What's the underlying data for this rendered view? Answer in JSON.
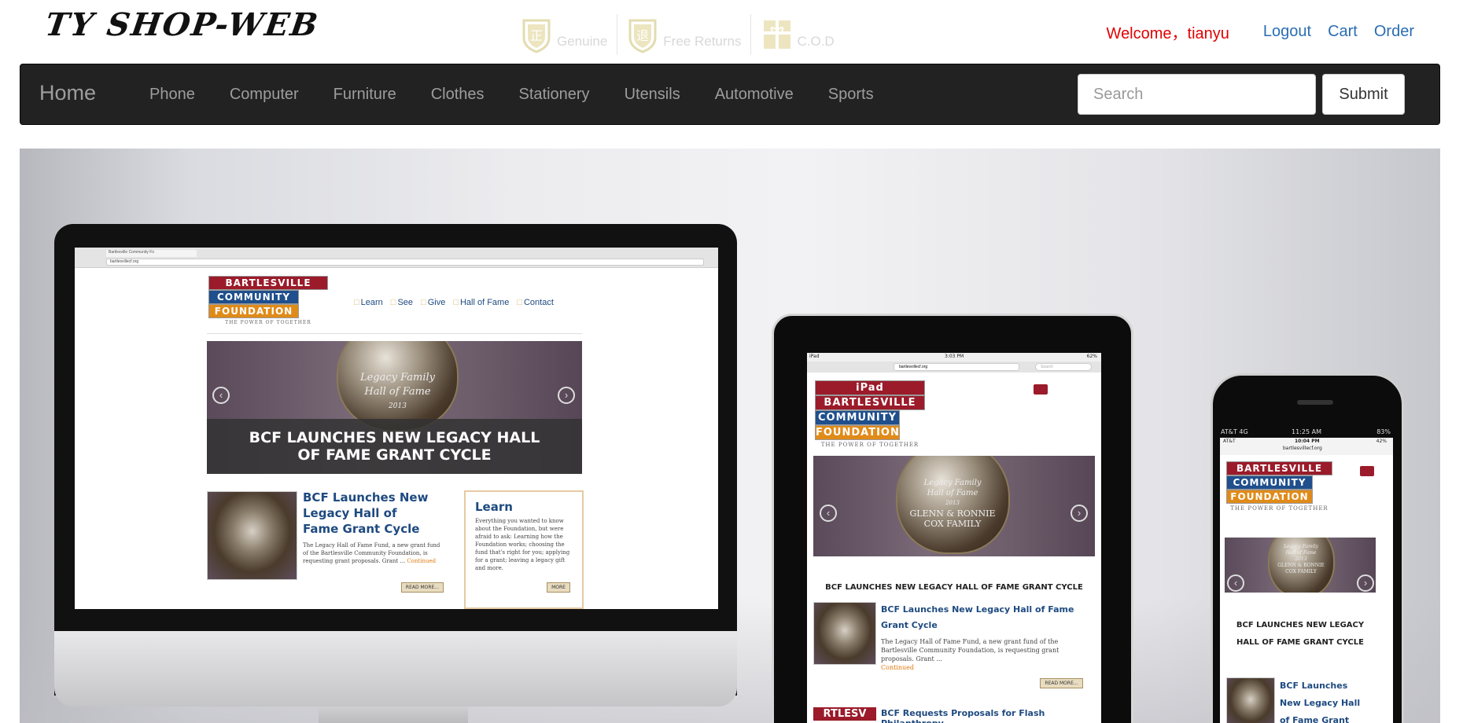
{
  "header": {
    "logo": "TY SHOP-WEB",
    "badges": [
      {
        "icon": "genuine-shield-icon",
        "glyph": "正",
        "label": "Genuine"
      },
      {
        "icon": "returns-shield-icon",
        "glyph": "退",
        "label": "Free Returns"
      },
      {
        "icon": "gift-box-icon",
        "glyph": "",
        "label": "C.O.D"
      }
    ],
    "welcome": "Welcome，tianyu",
    "links": {
      "logout": "Logout",
      "cart": "Cart",
      "order": "Order"
    }
  },
  "nav": {
    "home": "Home",
    "items": [
      "Phone",
      "Computer",
      "Furniture",
      "Clothes",
      "Stationery",
      "Utensils",
      "Automotive",
      "Sports"
    ],
    "search_placeholder": "Search",
    "submit": "Submit"
  },
  "banner": {
    "imac": {
      "tab_title": "Bartlesville Community Fo",
      "url": "bartlesvillecf.org",
      "logo": {
        "line1": "BARTLESVILLE",
        "line2": "COMMUNITY",
        "line3": "FOUNDATION",
        "tagline": "THE POWER OF TOGETHER"
      },
      "site_nav": [
        "Learn",
        "See",
        "Give",
        "Hall of Fame",
        "Contact"
      ],
      "trophy_text": [
        "Legacy Family",
        "Hall of Fame",
        "2013"
      ],
      "hero_caption": "BCF LAUNCHES NEW LEGACY HALL OF FAME GRANT CYCLE",
      "post_title": "BCF Launches New Legacy Hall of Fame Grant Cycle",
      "post_body": "The Legacy Hall of Fame Fund, a new grant fund of the Bartlesville Community Foundation, is requesting grant proposals. Grant ...",
      "continued": "Continued",
      "read_more": "READ MORE...",
      "learn_title": "Learn",
      "learn_body": "Everything you wanted to know about the Foundation, but were afraid to ask: Learning how the Foundation works; choosing the fund that's right for you; applying for a grant; leaving a legacy gift and more.",
      "more": "MORE"
    },
    "ipad": {
      "status_left": "iPad",
      "status_time": "3:03 PM",
      "status_right": "62%",
      "url": "bartlesvillecf.org",
      "search": "Search",
      "trophy_text": [
        "Legacy Family",
        "Hall of Fame",
        "2013",
        "GLENN & RONNIE",
        "COX FAMILY"
      ],
      "caption": "BCF LAUNCHES NEW LEGACY HALL OF FAME GRANT CYCLE",
      "post_title": "BCF Launches New Legacy Hall of Fame Grant Cycle",
      "post_body": "The Legacy Hall of Fame Fund, a new grant fund of the Bartlesville Community Foundation, is requesting grant proposals. Grant ...",
      "continued": "Continued",
      "read_more": "READ MORE...",
      "post2_badge": "RTLESV",
      "post2_title": "BCF Requests Proposals for Flash Philanthropy"
    },
    "iphone": {
      "status_outer_left": "AT&T 4G",
      "status_outer_time": "11:25 AM",
      "status_outer_right": "83%",
      "status_inner_left": "AT&T",
      "status_inner_time": "10:04 PM",
      "status_inner_right": "42%",
      "url": "bartlesvillecf.org",
      "trophy_text": [
        "Legacy Family",
        "Hall of Fame",
        "2013",
        "GLENN & RONNIE",
        "COX FAMILY"
      ],
      "caption": "BCF LAUNCHES NEW LEGACY HALL OF FAME GRANT CYCLE",
      "post_title": "BCF Launches New Legacy Hall of Fame Grant Cycle"
    }
  }
}
